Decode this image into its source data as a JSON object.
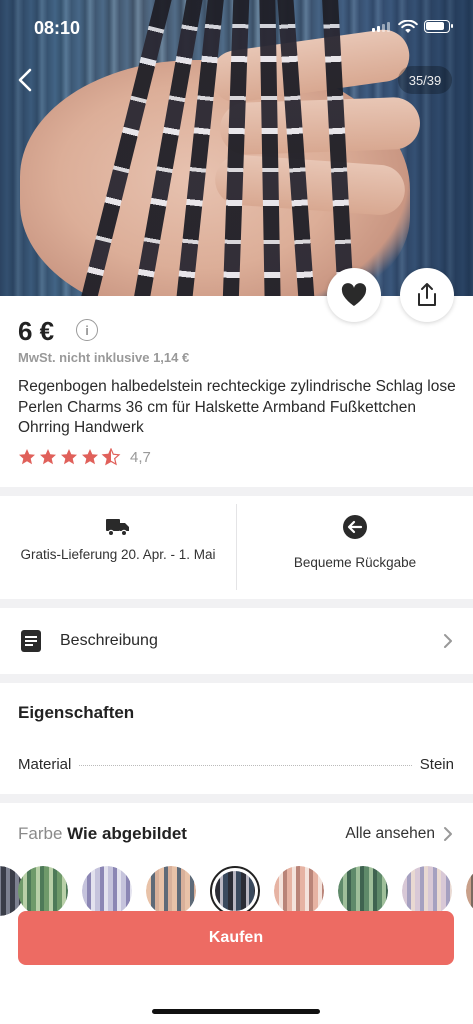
{
  "status_bar": {
    "time": "08:10"
  },
  "gallery": {
    "counter": "35/39"
  },
  "product": {
    "price": "6 €",
    "vat_note": "MwSt. nicht inklusive 1,14 €",
    "title": "Regenbogen halbedelstein rechteckige zylindrische Schlag lose Perlen Charms 36 cm für Halskette Armband Fußkettchen Ohrring Handwerk",
    "rating": "4,7",
    "stars_value": 4.5,
    "star_color": "#e0605a"
  },
  "shipping": {
    "delivery_text": "Gratis-Lieferung 20. Apr. - 1. Mai",
    "returns_text": "Bequeme Rückgabe"
  },
  "description": {
    "label": "Beschreibung"
  },
  "properties": {
    "title": "Eigenschaften",
    "rows": [
      {
        "name": "Material",
        "value": "Stein"
      }
    ]
  },
  "color": {
    "label": "Farbe",
    "value": "Wie abgebildet",
    "see_all": "Alle ansehen"
  },
  "buy_button": {
    "label": "Kaufen",
    "color": "#ed6b63"
  },
  "icons": [
    "back-chevron-icon",
    "heart-icon",
    "share-icon",
    "info-icon",
    "star-icon",
    "truck-icon",
    "return-arrow-icon",
    "document-icon",
    "chevron-right-icon"
  ]
}
